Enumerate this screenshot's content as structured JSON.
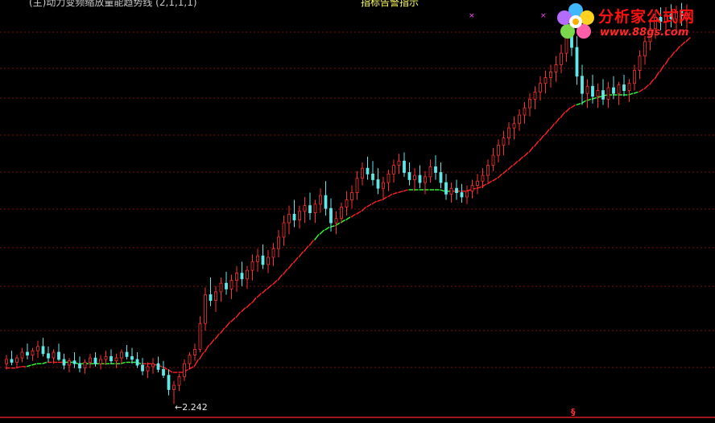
{
  "header": {
    "left_text": "(主)动力变频缩放量能趋势线 (2,1,1,1)",
    "mid_text": "指标告警指示"
  },
  "watermark": {
    "title": "分析家公式网",
    "url": "www.88gs.com"
  },
  "annotations": {
    "min_label": "←2.242",
    "signal_marker": "§"
  },
  "colors": {
    "background": "#000000",
    "gridline": "#7a1010",
    "candle_up": "#ff3030",
    "candle_down": "#60e8e8",
    "trend_up": "#ff2222",
    "trend_down": "#33ff33"
  },
  "chart_data": {
    "type": "candlestick",
    "title": "",
    "xlabel": "",
    "ylabel": "",
    "grid": true,
    "ylim": [
      2.13,
      5.05
    ],
    "min_value": 2.242,
    "bars": [
      [
        2.52,
        2.58,
        2.48,
        2.55
      ],
      [
        2.55,
        2.61,
        2.51,
        2.53
      ],
      [
        2.53,
        2.58,
        2.49,
        2.56
      ],
      [
        2.56,
        2.63,
        2.53,
        2.6
      ],
      [
        2.6,
        2.66,
        2.55,
        2.58
      ],
      [
        2.58,
        2.63,
        2.54,
        2.61
      ],
      [
        2.61,
        2.68,
        2.56,
        2.64
      ],
      [
        2.64,
        2.7,
        2.57,
        2.59
      ],
      [
        2.59,
        2.64,
        2.53,
        2.56
      ],
      [
        2.56,
        2.62,
        2.52,
        2.6
      ],
      [
        2.6,
        2.66,
        2.54,
        2.55
      ],
      [
        2.55,
        2.59,
        2.48,
        2.51
      ],
      [
        2.51,
        2.56,
        2.46,
        2.54
      ],
      [
        2.54,
        2.6,
        2.49,
        2.52
      ],
      [
        2.52,
        2.57,
        2.46,
        2.49
      ],
      [
        2.49,
        2.55,
        2.45,
        2.53
      ],
      [
        2.53,
        2.59,
        2.49,
        2.56
      ],
      [
        2.56,
        2.6,
        2.5,
        2.52
      ],
      [
        2.52,
        2.58,
        2.48,
        2.55
      ],
      [
        2.55,
        2.61,
        2.51,
        2.57
      ],
      [
        2.57,
        2.62,
        2.52,
        2.54
      ],
      [
        2.54,
        2.59,
        2.49,
        2.56
      ],
      [
        2.56,
        2.62,
        2.52,
        2.6
      ],
      [
        2.6,
        2.65,
        2.55,
        2.57
      ],
      [
        2.57,
        2.63,
        2.52,
        2.55
      ],
      [
        2.55,
        2.6,
        2.49,
        2.51
      ],
      [
        2.51,
        2.56,
        2.44,
        2.47
      ],
      [
        2.47,
        2.53,
        2.42,
        2.5
      ],
      [
        2.5,
        2.56,
        2.45,
        2.52
      ],
      [
        2.52,
        2.57,
        2.46,
        2.48
      ],
      [
        2.48,
        2.54,
        2.42,
        2.44
      ],
      [
        2.44,
        2.48,
        2.3,
        2.34
      ],
      [
        2.34,
        2.4,
        2.24,
        2.37
      ],
      [
        2.37,
        2.45,
        2.33,
        2.43
      ],
      [
        2.43,
        2.55,
        2.4,
        2.52
      ],
      [
        2.52,
        2.6,
        2.48,
        2.58
      ],
      [
        2.58,
        2.66,
        2.54,
        2.62
      ],
      [
        2.62,
        2.85,
        2.6,
        2.8
      ],
      [
        2.8,
        3.05,
        2.75,
        3.0
      ],
      [
        3.0,
        3.12,
        2.92,
        2.96
      ],
      [
        2.96,
        3.06,
        2.88,
        3.02
      ],
      [
        3.02,
        3.12,
        2.95,
        3.08
      ],
      [
        3.08,
        3.16,
        3.0,
        3.04
      ],
      [
        3.04,
        3.14,
        2.97,
        3.1
      ],
      [
        3.1,
        3.2,
        3.02,
        3.15
      ],
      [
        3.15,
        3.23,
        3.06,
        3.11
      ],
      [
        3.11,
        3.2,
        3.04,
        3.17
      ],
      [
        3.17,
        3.28,
        3.1,
        3.23
      ],
      [
        3.23,
        3.32,
        3.16,
        3.27
      ],
      [
        3.27,
        3.35,
        3.18,
        3.21
      ],
      [
        3.21,
        3.31,
        3.15,
        3.26
      ],
      [
        3.26,
        3.36,
        3.2,
        3.32
      ],
      [
        3.32,
        3.45,
        3.26,
        3.4
      ],
      [
        3.4,
        3.55,
        3.34,
        3.5
      ],
      [
        3.5,
        3.62,
        3.42,
        3.56
      ],
      [
        3.56,
        3.66,
        3.47,
        3.52
      ],
      [
        3.52,
        3.62,
        3.46,
        3.58
      ],
      [
        3.58,
        3.68,
        3.5,
        3.62
      ],
      [
        3.62,
        3.71,
        3.52,
        3.57
      ],
      [
        3.57,
        3.66,
        3.5,
        3.63
      ],
      [
        3.63,
        3.74,
        3.57,
        3.69
      ],
      [
        3.69,
        3.79,
        3.55,
        3.6
      ],
      [
        3.6,
        3.67,
        3.44,
        3.5
      ],
      [
        3.5,
        3.58,
        3.42,
        3.53
      ],
      [
        3.53,
        3.64,
        3.5,
        3.61
      ],
      [
        3.61,
        3.72,
        3.55,
        3.66
      ],
      [
        3.66,
        3.76,
        3.6,
        3.71
      ],
      [
        3.71,
        3.86,
        3.66,
        3.81
      ],
      [
        3.81,
        3.92,
        3.76,
        3.88
      ],
      [
        3.88,
        3.96,
        3.8,
        3.84
      ],
      [
        3.84,
        3.93,
        3.76,
        3.8
      ],
      [
        3.8,
        3.88,
        3.7,
        3.74
      ],
      [
        3.74,
        3.82,
        3.66,
        3.78
      ],
      [
        3.78,
        3.87,
        3.72,
        3.84
      ],
      [
        3.84,
        3.94,
        3.78,
        3.9
      ],
      [
        3.9,
        3.98,
        3.84,
        3.93
      ],
      [
        3.93,
        3.99,
        3.82,
        3.85
      ],
      [
        3.85,
        3.92,
        3.76,
        3.8
      ],
      [
        3.8,
        3.88,
        3.72,
        3.83
      ],
      [
        3.83,
        3.9,
        3.74,
        3.78
      ],
      [
        3.78,
        3.86,
        3.7,
        3.82
      ],
      [
        3.82,
        3.94,
        3.78,
        3.89
      ],
      [
        3.89,
        3.97,
        3.8,
        3.85
      ],
      [
        3.85,
        3.92,
        3.74,
        3.78
      ],
      [
        3.78,
        3.84,
        3.66,
        3.7
      ],
      [
        3.7,
        3.78,
        3.64,
        3.74
      ],
      [
        3.74,
        3.8,
        3.66,
        3.71
      ],
      [
        3.71,
        3.77,
        3.64,
        3.68
      ],
      [
        3.68,
        3.76,
        3.63,
        3.72
      ],
      [
        3.72,
        3.8,
        3.67,
        3.76
      ],
      [
        3.76,
        3.84,
        3.7,
        3.79
      ],
      [
        3.79,
        3.88,
        3.74,
        3.83
      ],
      [
        3.83,
        3.94,
        3.78,
        3.9
      ],
      [
        3.9,
        4.02,
        3.86,
        3.97
      ],
      [
        3.97,
        4.08,
        3.92,
        4.04
      ],
      [
        4.04,
        4.14,
        3.97,
        4.09
      ],
      [
        4.09,
        4.2,
        4.04,
        4.16
      ],
      [
        4.16,
        4.24,
        4.08,
        4.19
      ],
      [
        4.19,
        4.29,
        4.14,
        4.25
      ],
      [
        4.25,
        4.34,
        4.19,
        4.3
      ],
      [
        4.3,
        4.4,
        4.24,
        4.36
      ],
      [
        4.36,
        4.45,
        4.29,
        4.41
      ],
      [
        4.41,
        4.52,
        4.35,
        4.47
      ],
      [
        4.47,
        4.56,
        4.4,
        4.51
      ],
      [
        4.51,
        4.6,
        4.44,
        4.55
      ],
      [
        4.55,
        4.66,
        4.48,
        4.6
      ],
      [
        4.6,
        4.74,
        4.54,
        4.68
      ],
      [
        4.68,
        4.9,
        4.62,
        4.82
      ],
      [
        4.82,
        4.95,
        4.66,
        4.72
      ],
      [
        4.72,
        4.8,
        4.46,
        4.52
      ],
      [
        4.52,
        4.6,
        4.32,
        4.4
      ],
      [
        4.4,
        4.5,
        4.3,
        4.45
      ],
      [
        4.45,
        4.53,
        4.33,
        4.38
      ],
      [
        4.38,
        4.47,
        4.3,
        4.42
      ],
      [
        4.42,
        4.5,
        4.32,
        4.36
      ],
      [
        4.36,
        4.48,
        4.3,
        4.44
      ],
      [
        4.44,
        4.52,
        4.36,
        4.4
      ],
      [
        4.4,
        4.48,
        4.32,
        4.46
      ],
      [
        4.46,
        4.53,
        4.38,
        4.42
      ],
      [
        4.42,
        4.5,
        4.34,
        4.47
      ],
      [
        4.47,
        4.6,
        4.42,
        4.56
      ],
      [
        4.56,
        4.7,
        4.5,
        4.66
      ],
      [
        4.66,
        4.8,
        4.6,
        4.76
      ],
      [
        4.76,
        4.9,
        4.7,
        4.85
      ],
      [
        4.85,
        4.98,
        4.78,
        4.93
      ],
      [
        4.93,
        5.0,
        4.84,
        4.9
      ],
      [
        4.9,
        5.0,
        4.8,
        4.95
      ],
      [
        4.95,
        5.02,
        4.86,
        4.92
      ],
      [
        4.92,
        5.01,
        4.84,
        4.97
      ],
      [
        4.97,
        5.03,
        4.87,
        4.94
      ],
      [
        4.94,
        5.02,
        4.85,
        4.96
      ]
    ],
    "trend_line": {
      "values": [
        2.49,
        2.49,
        2.49,
        2.5,
        2.5,
        2.51,
        2.52,
        2.52,
        2.53,
        2.53,
        2.53,
        2.53,
        2.53,
        2.53,
        2.52,
        2.52,
        2.52,
        2.52,
        2.52,
        2.52,
        2.52,
        2.52,
        2.52,
        2.53,
        2.53,
        2.53,
        2.52,
        2.52,
        2.52,
        2.51,
        2.5,
        2.48,
        2.46,
        2.46,
        2.46,
        2.48,
        2.5,
        2.55,
        2.6,
        2.65,
        2.69,
        2.73,
        2.77,
        2.81,
        2.84,
        2.88,
        2.91,
        2.94,
        2.98,
        3.01,
        3.04,
        3.07,
        3.1,
        3.14,
        3.18,
        3.22,
        3.26,
        3.3,
        3.34,
        3.38,
        3.42,
        3.45,
        3.47,
        3.48,
        3.5,
        3.52,
        3.54,
        3.56,
        3.58,
        3.61,
        3.63,
        3.65,
        3.66,
        3.68,
        3.7,
        3.71,
        3.72,
        3.73,
        3.73,
        3.73,
        3.73,
        3.73,
        3.73,
        3.73,
        3.72,
        3.72,
        3.72,
        3.72,
        3.72,
        3.73,
        3.74,
        3.75,
        3.77,
        3.79,
        3.81,
        3.84,
        3.87,
        3.9,
        3.93,
        3.96,
        3.99,
        4.03,
        4.07,
        4.11,
        4.15,
        4.19,
        4.23,
        4.27,
        4.3,
        4.32,
        4.33,
        4.35,
        4.36,
        4.37,
        4.38,
        4.39,
        4.39,
        4.39,
        4.39,
        4.39,
        4.4,
        4.41,
        4.43,
        4.46,
        4.5,
        4.55,
        4.6,
        4.65,
        4.69,
        4.73,
        4.76,
        4.79
      ],
      "down_segments": [
        [
          4,
          7
        ],
        [
          11,
          25
        ],
        [
          59,
          65
        ],
        [
          77,
          84
        ],
        [
          109,
          120
        ]
      ]
    }
  }
}
